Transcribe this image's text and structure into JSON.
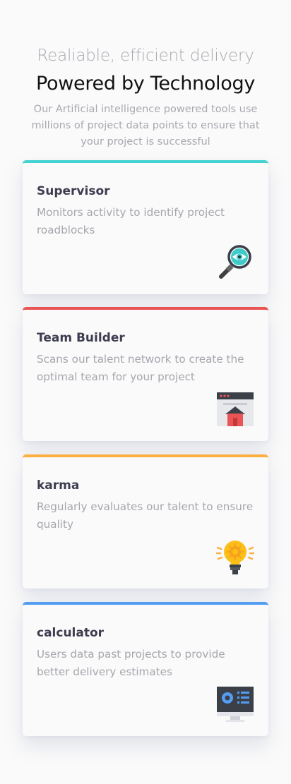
{
  "header": {
    "subtitle": "Realiable, efficient delivery",
    "title": "Powered by Technology",
    "description": "Our Artificial intelligence powered tools use millions of project data points to ensure that your project is successful"
  },
  "cards": [
    {
      "title": "Supervisor",
      "text": "Monitors activity to identify project roadblocks",
      "accent": "#44d3d2",
      "icon": "magnifier-eye-icon"
    },
    {
      "title": "Team Builder",
      "text": "Scans our talent network to create the optimal team for your project",
      "accent": "#ea5454",
      "icon": "browser-home-icon"
    },
    {
      "title": "karma",
      "text": "Regularly evaluates our talent to ensure quality",
      "accent": "#fcaf41",
      "icon": "lightbulb-icon"
    },
    {
      "title": "calculator",
      "text": "Users data past projects to provide better delivery estimates",
      "accent": "#549ef2",
      "icon": "monitor-dashboard-icon"
    }
  ]
}
